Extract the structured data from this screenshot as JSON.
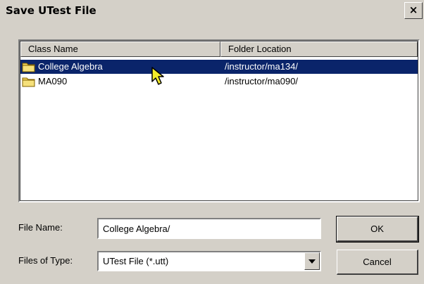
{
  "window": {
    "title": "Save UTest File",
    "close_glyph": "×"
  },
  "list": {
    "headers": {
      "name": "Class Name",
      "location": "Folder Location"
    },
    "rows": [
      {
        "name": "College Algebra",
        "location": "/instructor/ma134/",
        "selected": true,
        "icon": "folder-icon"
      },
      {
        "name": "MA090",
        "location": "/instructor/ma090/",
        "selected": false,
        "icon": "folder-icon"
      }
    ]
  },
  "form": {
    "file_name_label": "File Name:",
    "file_name_value": "College Algebra/",
    "file_type_label": "Files of Type:",
    "file_type_value": "UTest File (*.utt)"
  },
  "buttons": {
    "ok": "OK",
    "cancel": "Cancel"
  },
  "colors": {
    "selection": "#0a246a",
    "face": "#d4d0c8",
    "folder": "#f2d35a"
  }
}
